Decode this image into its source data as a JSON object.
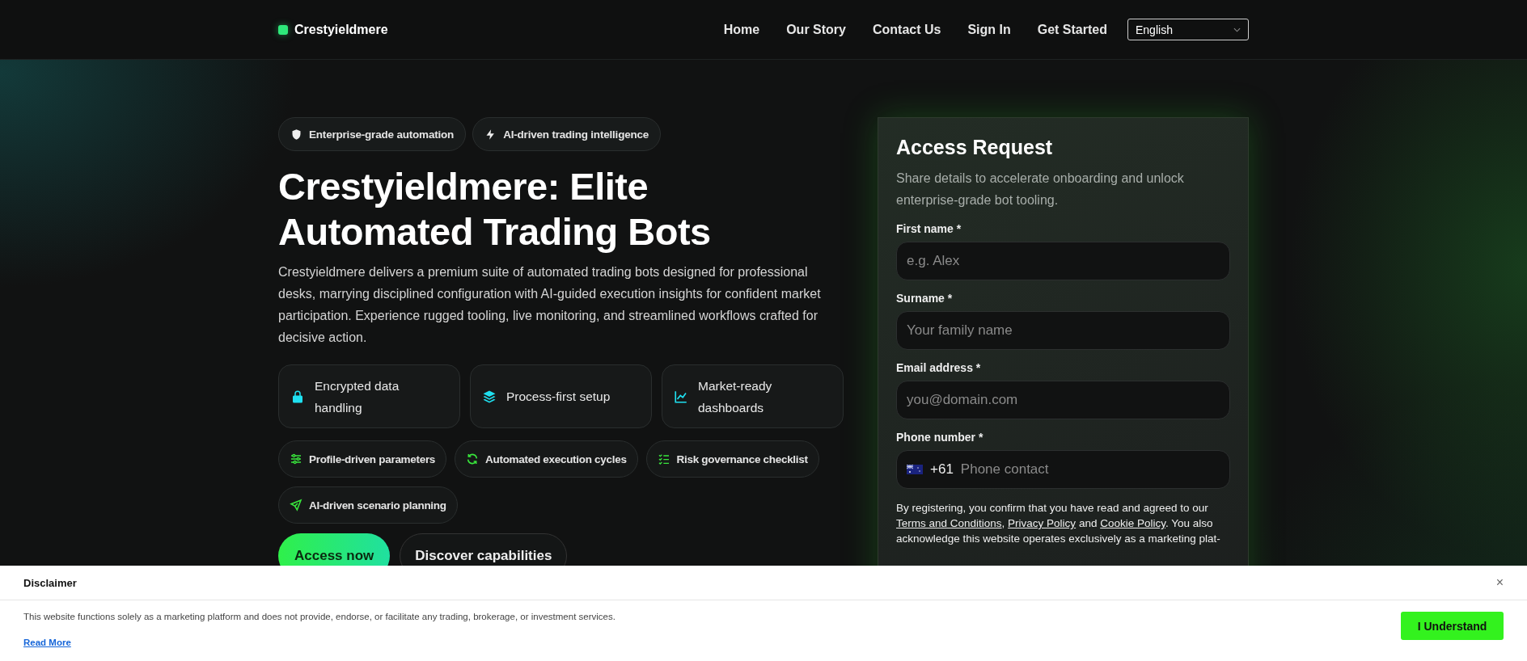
{
  "header": {
    "brand": "Crestyieldmere",
    "nav": [
      "Home",
      "Our Story",
      "Contact Us",
      "Sign In",
      "Get Started"
    ],
    "language": "English"
  },
  "hero": {
    "badges": [
      {
        "label": "Enterprise-grade automation"
      },
      {
        "label": "AI-driven trading intelligence"
      }
    ],
    "title": "Crestyieldmere: Elite Automated Trading Bots",
    "description": "Crestyieldmere delivers a premium suite of automated trading bots designed for professional desks, marrying disciplined configuration with AI-guided execution insights for confident market participation. Experience rugged tooling, live monitoring, and streamlined workflows crafted for decisive action.",
    "features": [
      {
        "label": "Encrypted data handling"
      },
      {
        "label": "Process-first setup"
      },
      {
        "label": "Market-ready dashboards"
      }
    ],
    "pills": [
      {
        "label": "Profile-driven parameters"
      },
      {
        "label": "Automated execution cycles"
      },
      {
        "label": "Risk governance checklist"
      },
      {
        "label": "AI-driven scenario planning"
      }
    ],
    "primary_button": "Access now",
    "secondary_button": "Discover capabilities"
  },
  "form": {
    "title": "Access Request",
    "subtitle": "Share details to accelerate onboarding and unlock enterprise-grade bot tooling.",
    "fields": [
      {
        "kind": "text",
        "label": "First name *",
        "placeholder": "e.g. Alex"
      },
      {
        "kind": "text",
        "label": "Surname *",
        "placeholder": "Your family name"
      },
      {
        "kind": "text",
        "label": "Email address *",
        "placeholder": "you@domain.com"
      },
      {
        "kind": "phone",
        "label": "Phone number *",
        "prefix": "+61",
        "placeholder": "Phone contact"
      }
    ],
    "consent": {
      "before": "By registering, you confirm that you have read and agreed to our ",
      "links": [
        "Terms and Conditions",
        "Privacy Policy",
        "Cookie Policy"
      ],
      "joins": [
        ", ",
        " and "
      ],
      "after": ". You also acknowledge this website operates exclusively as a marketing plat-"
    }
  },
  "disclaimer": {
    "title": "Disclaimer",
    "close": "×",
    "text": "This website functions solely as a marketing platform and does not provide, endorse, or facilitate any trading, brokerage, or investment services.",
    "link": "Read More",
    "button": "I Understand"
  }
}
